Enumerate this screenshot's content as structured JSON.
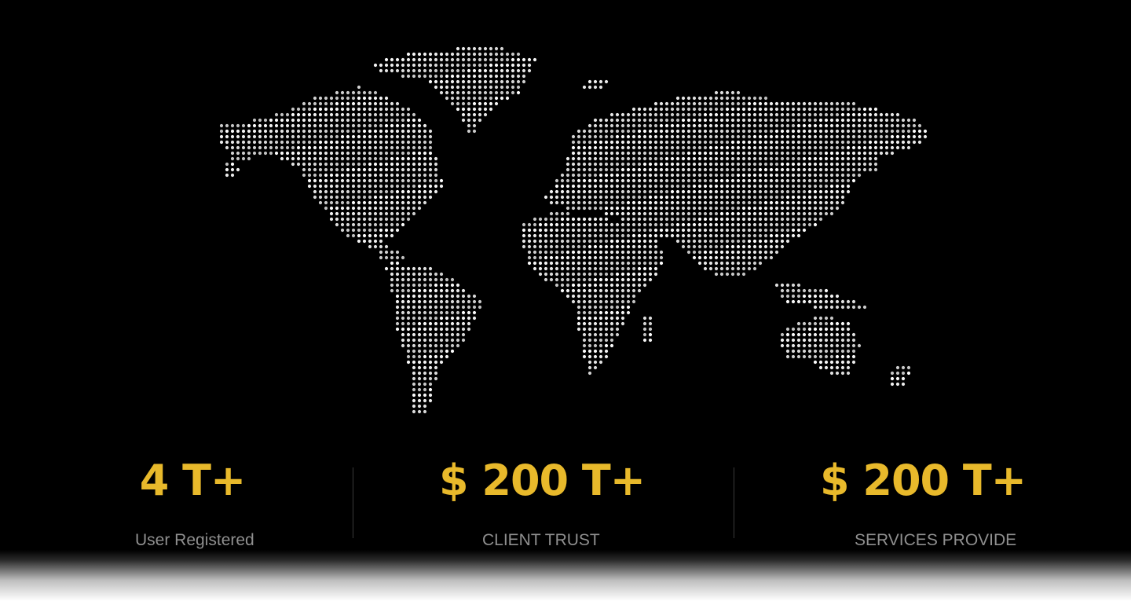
{
  "map": {
    "icon": "world-map-dotted",
    "dot_color": "#ffffff"
  },
  "stats": [
    {
      "value": "4 T+",
      "label": "User Registered"
    },
    {
      "value": "$ 200 T+",
      "label": "CLIENT TRUST"
    },
    {
      "value": "$ 200 T+",
      "label": "SERVICES PROVIDE"
    }
  ],
  "colors": {
    "background": "#000000",
    "accent": "#e8b92b",
    "label": "#8f8f8f",
    "divider": "#3a3a3a"
  }
}
